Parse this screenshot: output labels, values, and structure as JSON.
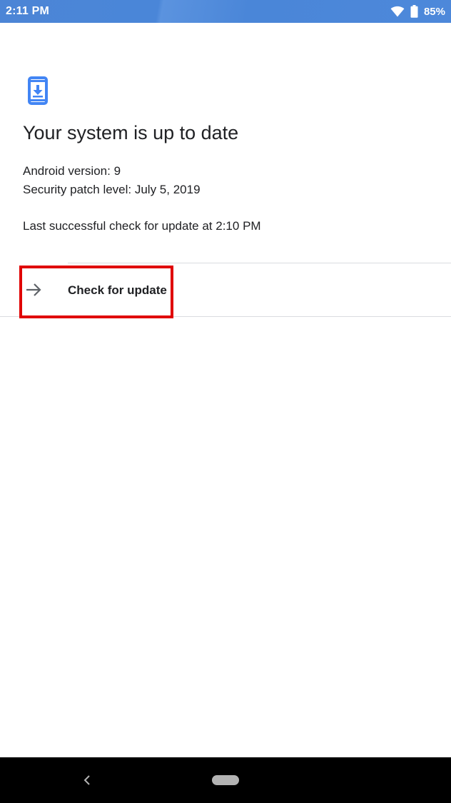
{
  "status_bar": {
    "time": "2:11 PM",
    "battery_percent": "85%",
    "icons": [
      "wifi-icon",
      "battery-icon"
    ]
  },
  "main": {
    "icon": "system-update-icon",
    "title": "Your system is up to date",
    "android_version": "Android version: 9",
    "security_patch": "Security patch level: July 5, 2019",
    "last_check": "Last successful check for update at 2:10 PM"
  },
  "action": {
    "icon": "arrow-right-icon",
    "label": "Check for update"
  },
  "nav_bar": {
    "icons": [
      "back-icon",
      "home-pill-icon"
    ]
  },
  "colors": {
    "status_bar": "#4a86d8",
    "accent_icon": "#4285f4",
    "highlight": "#e00000",
    "nav_bar": "#000000"
  }
}
